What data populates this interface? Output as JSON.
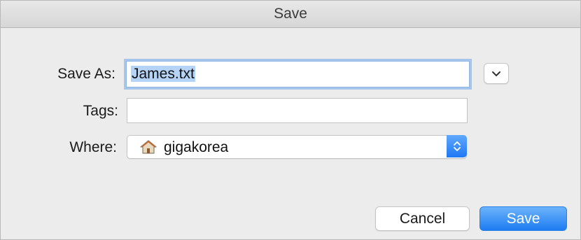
{
  "dialog": {
    "title": "Save"
  },
  "form": {
    "save_as_label": "Save As:",
    "save_as_value": "James.txt",
    "tags_label": "Tags:",
    "tags_value": "",
    "where_label": "Where:",
    "where_value": "gigakorea",
    "where_icon": "home-folder-icon"
  },
  "buttons": {
    "expand_icon": "chevron-down-icon",
    "cancel_label": "Cancel",
    "save_label": "Save"
  },
  "colors": {
    "accent": "#1d7cf2",
    "selection": "#b4d3f6",
    "focus_ring": "#a7c6ee"
  }
}
